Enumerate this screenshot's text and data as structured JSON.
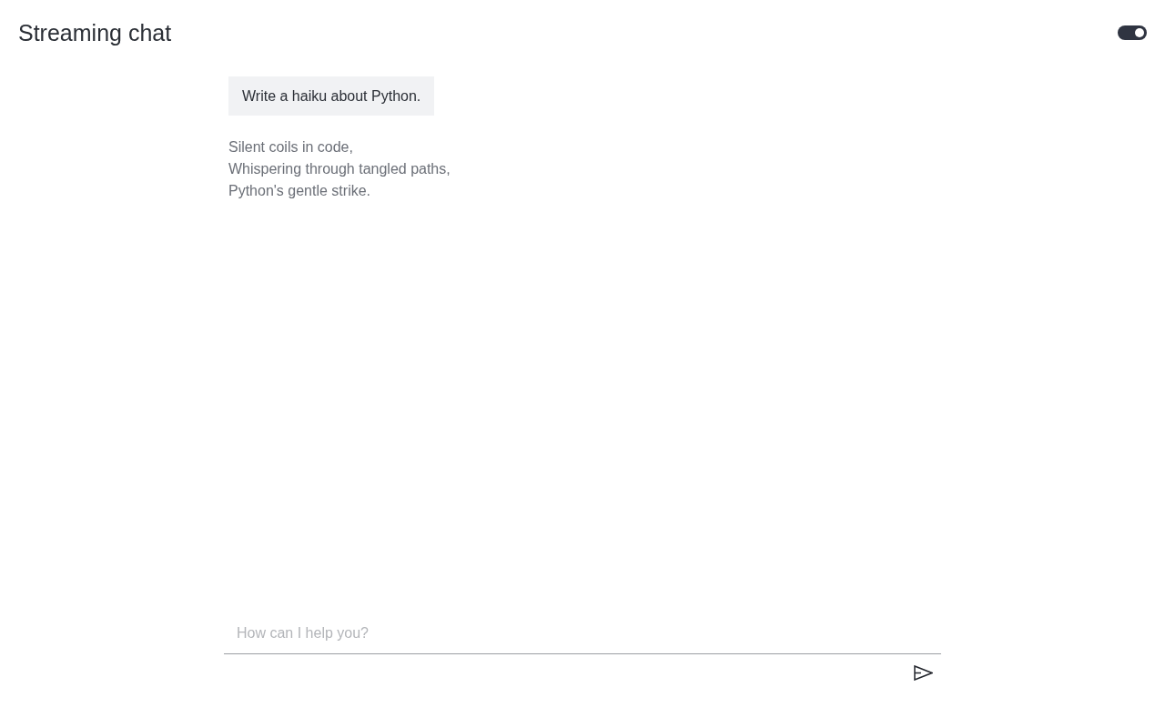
{
  "header": {
    "title": "Streaming chat",
    "theme_toggle": {
      "on": true
    }
  },
  "messages": [
    {
      "kind": "user",
      "text": "Write a haiku about Python."
    },
    {
      "kind": "assistant",
      "text": "Silent coils in code,\nWhispering through tangled paths,\nPython's gentle strike."
    }
  ],
  "composer": {
    "placeholder": "How can I help you?"
  }
}
